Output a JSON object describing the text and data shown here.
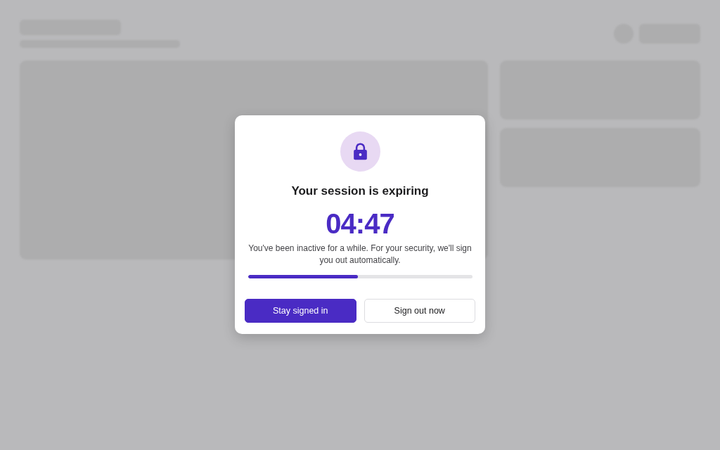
{
  "dialog": {
    "title": "Your session is expiring",
    "countdown": "04:47",
    "message": "You've been inactive for a while. For your security, we'll sign you out automatically.",
    "progress": {
      "level": 0.49
    },
    "buttons": [
      {
        "label": "Stay signed in",
        "kind": "primary"
      },
      {
        "label": "Sign out now",
        "kind": "secondary"
      }
    ]
  }
}
